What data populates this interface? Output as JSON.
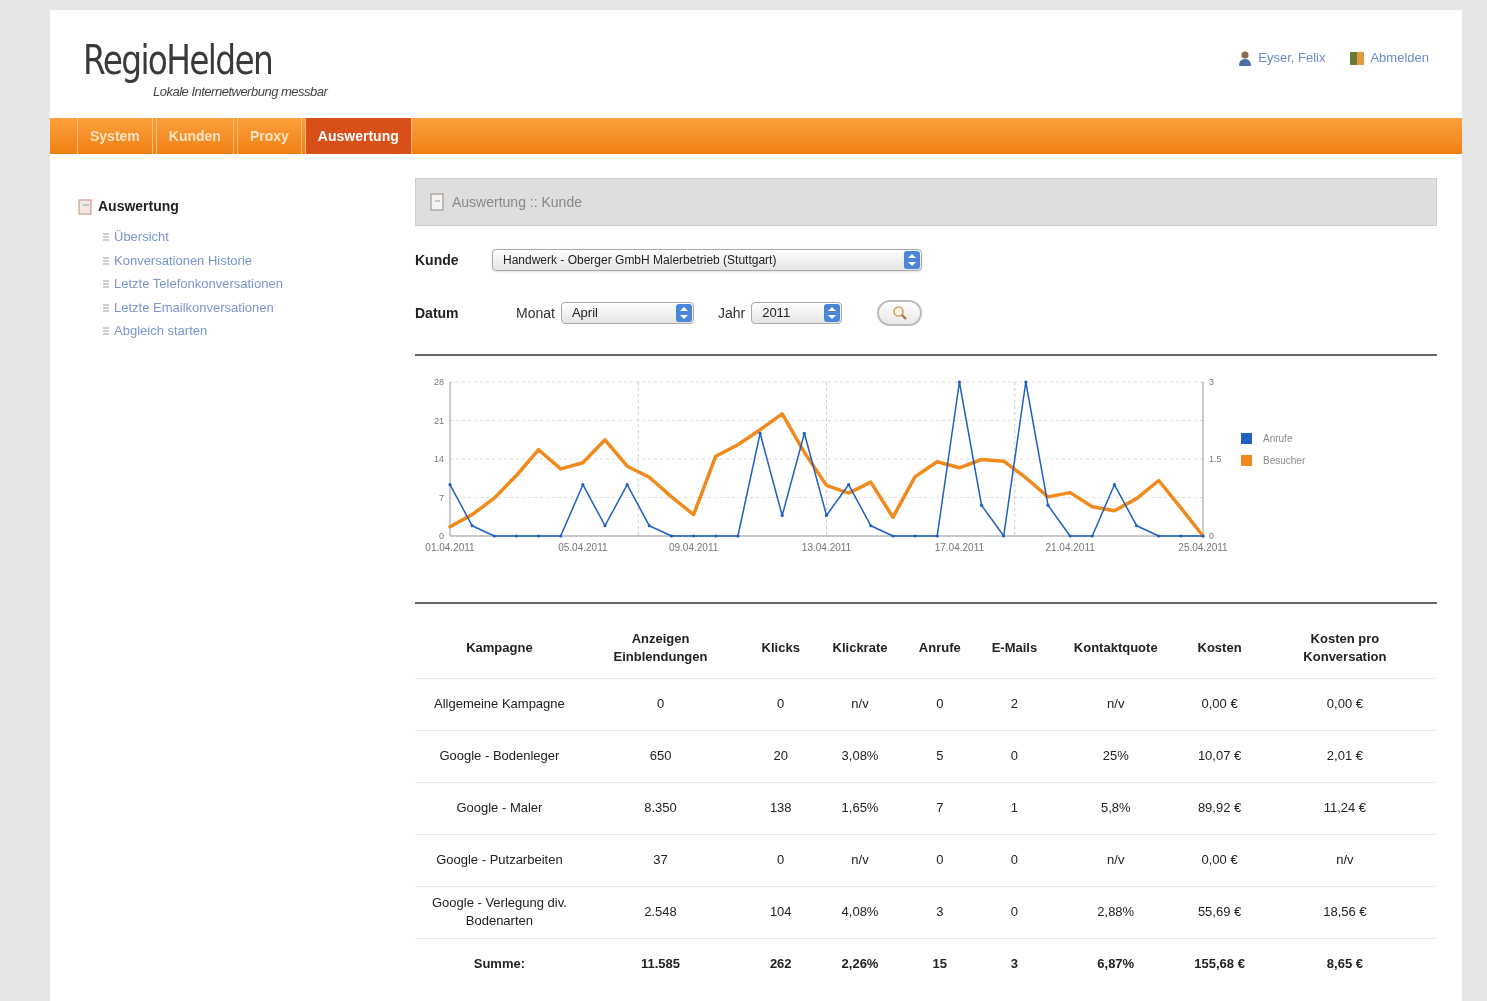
{
  "logo": {
    "title": "RegioHelden",
    "tagline": "Lokale Internetwerbung messbar"
  },
  "user_links": [
    {
      "kind": "user",
      "label": "Eyser, Felix"
    },
    {
      "kind": "logout",
      "label": "Abmelden"
    }
  ],
  "tabs": [
    {
      "label": "System",
      "selected": false
    },
    {
      "label": "Kunden",
      "selected": false
    },
    {
      "label": "Proxy",
      "selected": false
    },
    {
      "label": "Auswertung",
      "selected": true
    }
  ],
  "sidebar": {
    "title": "Auswertung",
    "items": [
      "Übersicht",
      "Konversationen Historie",
      "Letzte Telefonkonversationen",
      "Letzte Emailkonversationen",
      "Abgleich starten"
    ]
  },
  "breadcrumb": "Auswertung :: Kunde",
  "filters": {
    "customer_label": "Kunde",
    "customer_value": "Handwerk - Oberger GmbH Malerbetrieb (Stuttgart)",
    "date_label": "Datum",
    "month_label": "Monat",
    "month_value": "April",
    "year_label": "Jahr",
    "year_value": "2011"
  },
  "chart_data": {
    "type": "line",
    "categories": [
      "01.04.2011",
      null,
      null,
      null,
      null,
      null,
      "05.04.2011",
      null,
      null,
      null,
      null,
      "09.04.2011",
      null,
      null,
      null,
      null,
      null,
      "13.04.2011",
      null,
      null,
      null,
      null,
      null,
      "17.04.2011",
      null,
      null,
      null,
      null,
      "21.04.2011",
      null,
      null,
      null,
      null,
      null,
      "25.04.2011"
    ],
    "grid": true,
    "legend": "right",
    "ylim": [
      0,
      28
    ],
    "yticks": [
      0,
      7,
      14,
      21,
      28
    ],
    "y2lim": [
      0,
      3
    ],
    "y2ticks": [
      0,
      {
        "value": 1.5,
        "label": "1.5"
      },
      3
    ],
    "series": [
      {
        "name": "Anrufe",
        "color": "#1f5fc4",
        "axis": "y2",
        "values": [
          1,
          0.2,
          0,
          0,
          0,
          0,
          1,
          0.2,
          1,
          0.2,
          0,
          0,
          0,
          0,
          2,
          0.4,
          2,
          0.4,
          1,
          0.2,
          0,
          0,
          0,
          3,
          0.6,
          0,
          3,
          0.6,
          0,
          0,
          1,
          0.2,
          0,
          0,
          0
        ]
      },
      {
        "name": "Besucher",
        "color": "#f08a1c",
        "values": [
          1.7,
          3.9,
          6.9,
          11,
          15.7,
          12.2,
          13.3,
          17.5,
          12.7,
          10.7,
          7.1,
          3.9,
          14.5,
          16.6,
          19.3,
          22.2,
          15.2,
          9.2,
          7.8,
          9.8,
          3.4,
          10.8,
          13.5,
          12.4,
          13.9,
          13.6,
          10.6,
          7.1,
          7.9,
          5.3,
          4.6,
          6.8,
          10.1,
          5.1,
          0
        ]
      }
    ]
  },
  "table": {
    "columns": [
      "Kampagne",
      "Anzeigen Einblendungen",
      "Klicks",
      "Klickrate",
      "Anrufe",
      "E-Mails",
      "Kontaktquote",
      "Kosten",
      "Kosten pro Konversation"
    ],
    "rows": [
      {
        "total": false,
        "cells": [
          "Allgemeine Kampagne",
          "0",
          "0",
          "n/v",
          "0",
          "2",
          "n/v",
          "0,00 €",
          "0,00 €"
        ]
      },
      {
        "total": false,
        "cells": [
          "Google - Bodenleger",
          "650",
          "20",
          "3,08%",
          "5",
          "0",
          "25%",
          "10,07 €",
          "2,01 €"
        ]
      },
      {
        "total": false,
        "cells": [
          "Google - Maler",
          "8.350",
          "138",
          "1,65%",
          "7",
          "1",
          "5,8%",
          "89,92 €",
          "11,24 €"
        ]
      },
      {
        "total": false,
        "cells": [
          "Google - Putzarbeiten",
          "37",
          "0",
          "n/v",
          "0",
          "0",
          "n/v",
          "0,00 €",
          "n/v"
        ]
      },
      {
        "total": false,
        "cells": [
          "Google - Verlegung div. Bodenarten",
          "2.548",
          "104",
          "4,08%",
          "3",
          "0",
          "2,88%",
          "55,69 €",
          "18,56 €"
        ]
      },
      {
        "total": true,
        "cells": [
          "Summe:",
          "11.585",
          "262",
          "2,26%",
          "15",
          "3",
          "6,87%",
          "155,68 €",
          "8,65 €"
        ]
      }
    ]
  }
}
